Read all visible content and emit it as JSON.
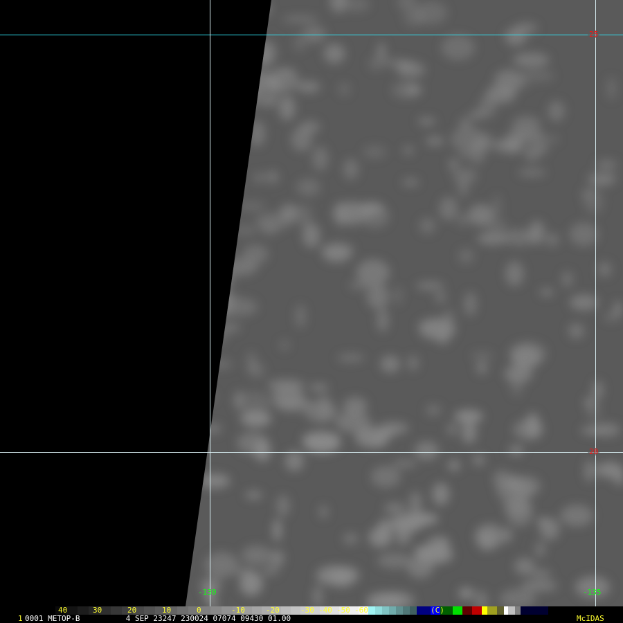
{
  "grid": {
    "lat_labels": [
      "25",
      "20"
    ],
    "lon_labels": [
      "-130",
      "-135"
    ]
  },
  "colorbar": {
    "ticks": [
      "40",
      "30",
      "20",
      "10",
      "0",
      "-10",
      "-20",
      "-30",
      "-40",
      "-50",
      "-60"
    ],
    "unit_label": "(C)"
  },
  "info": {
    "frame": "1",
    "text": "0001 METOP-B          4 SEP 23247 230024 07074 09430 01.00",
    "brand": "McIDAS"
  },
  "colors": {
    "grid": "#d8eef2",
    "lat_label": "#ff1010",
    "lon_label": "#10ff10",
    "tick": "#ffff30"
  }
}
